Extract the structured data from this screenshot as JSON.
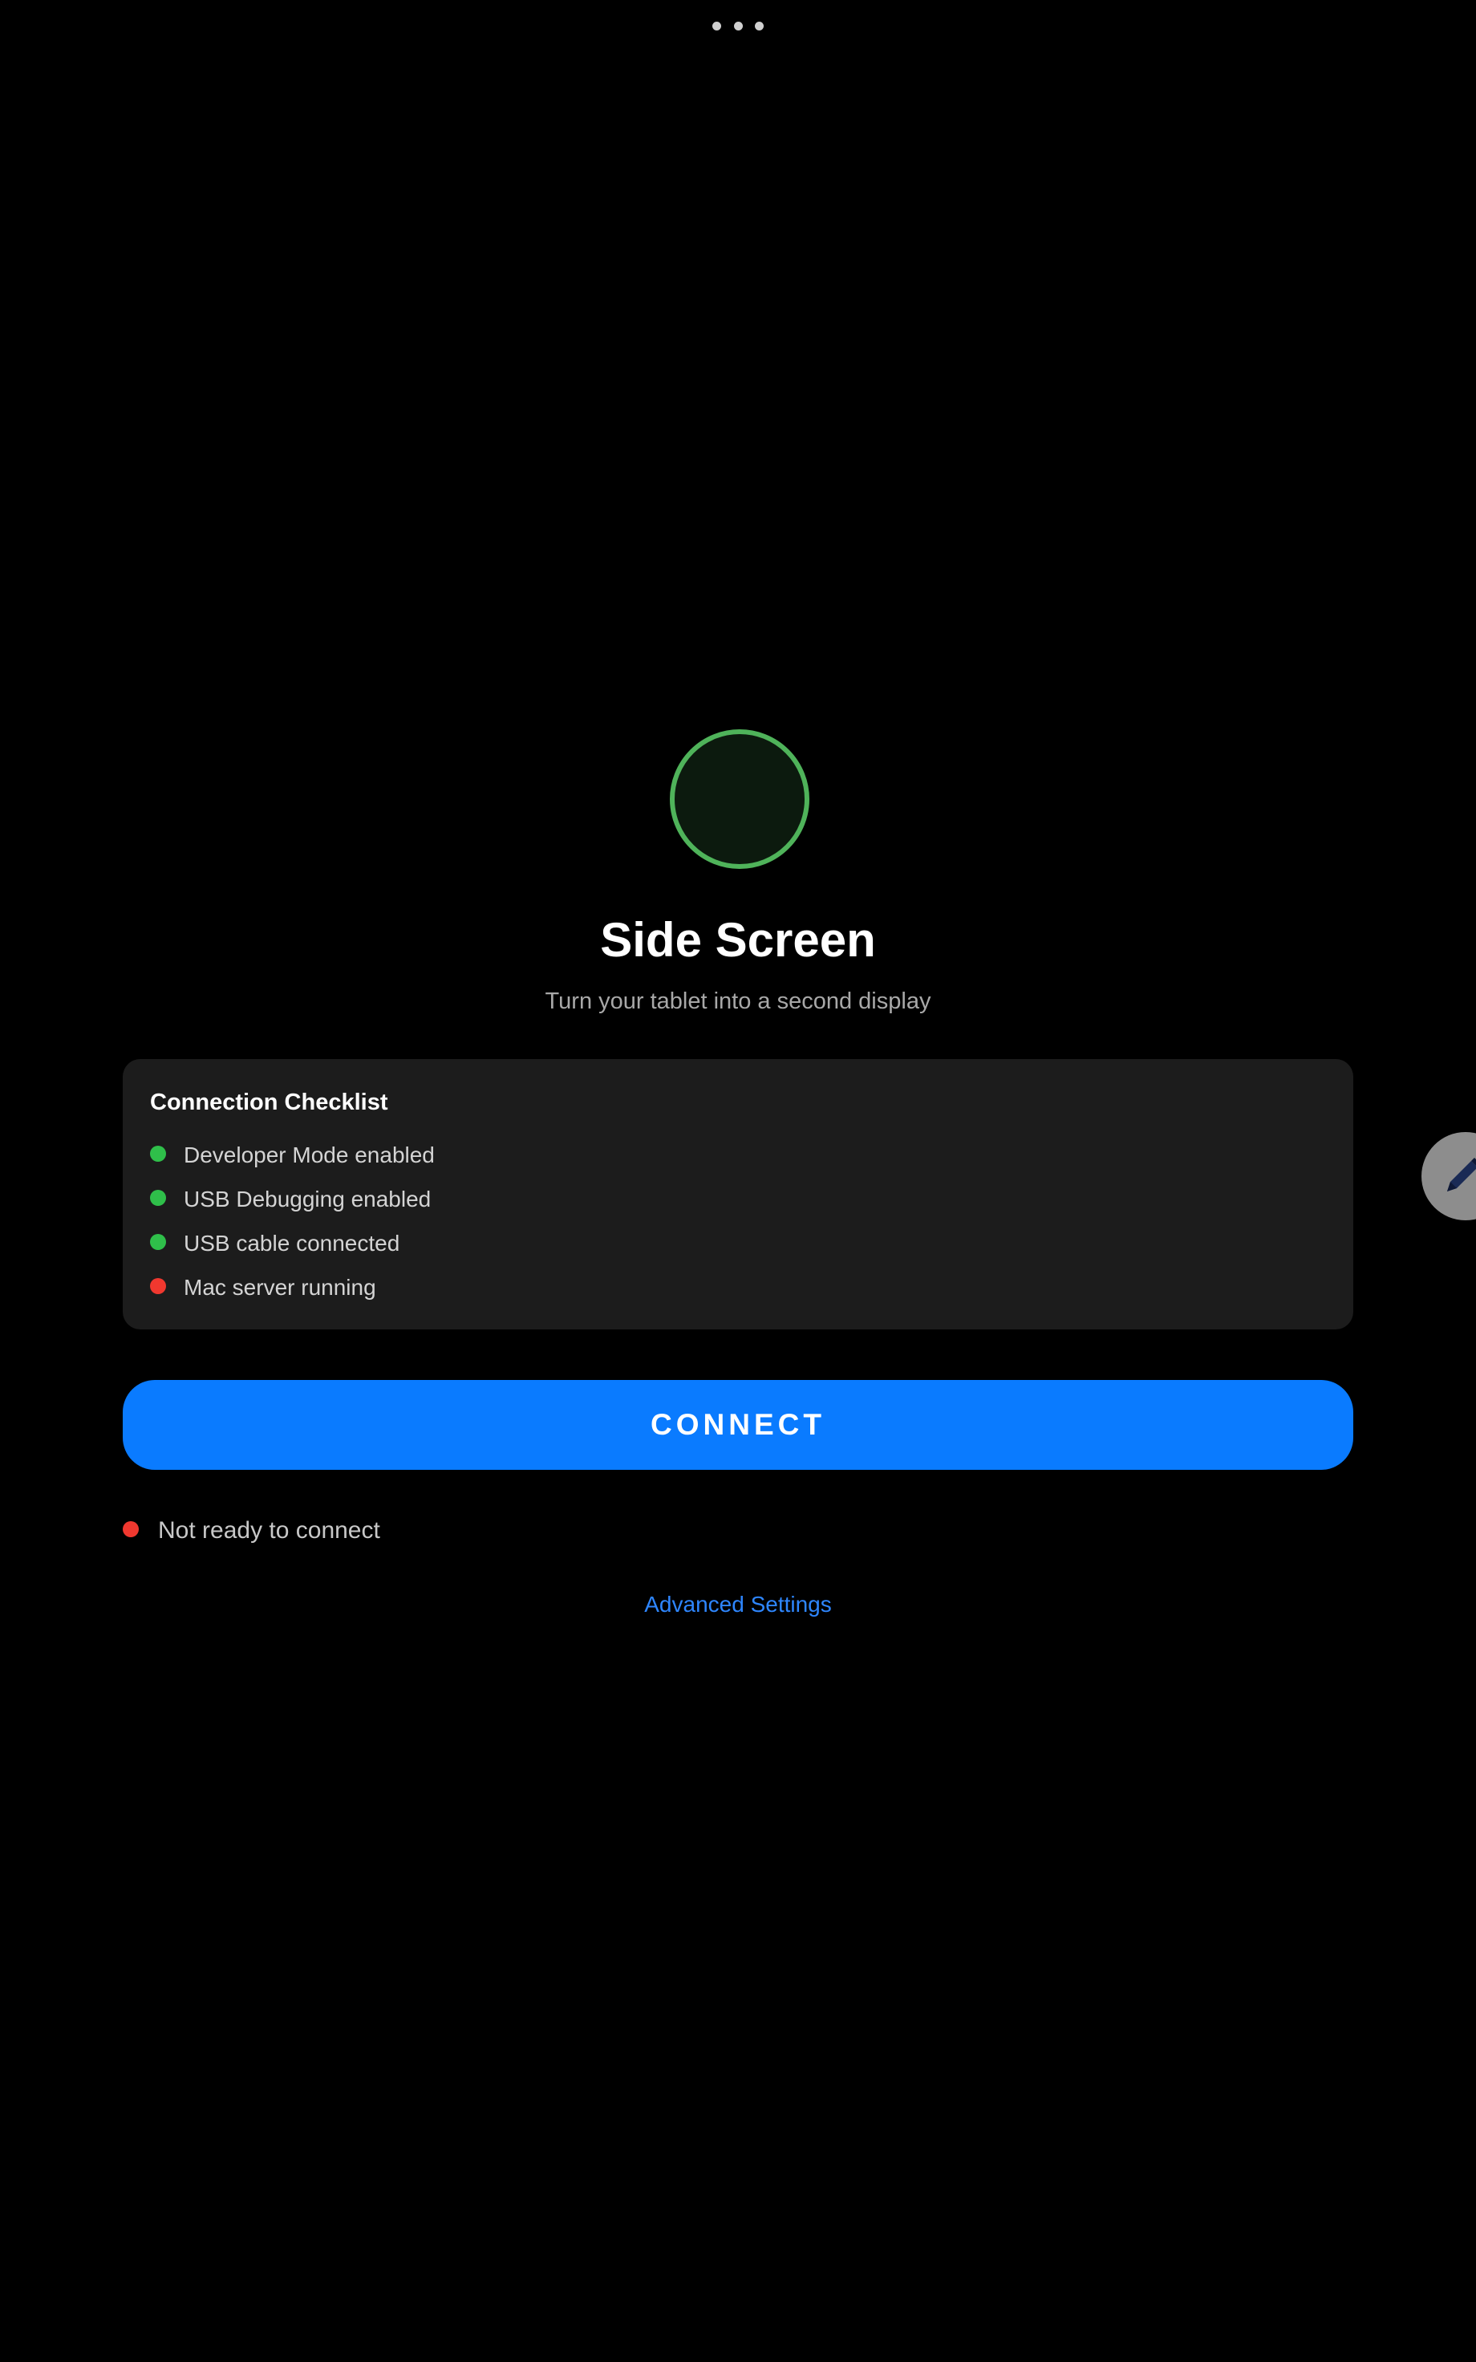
{
  "app": {
    "title": "Side Screen",
    "subtitle": "Turn your tablet into a second display"
  },
  "top_bar": {
    "menu_icon": "more-dots-icon"
  },
  "status_indicator": {
    "icon": "status-ring-icon",
    "color": "#4fb35a"
  },
  "checklist": {
    "title": "Connection Checklist",
    "items": [
      {
        "label": "Developer Mode enabled",
        "status": "ok",
        "color": "#2fbf4a"
      },
      {
        "label": "USB Debugging enabled",
        "status": "ok",
        "color": "#2fbf4a"
      },
      {
        "label": "USB cable connected",
        "status": "ok",
        "color": "#2fbf4a"
      },
      {
        "label": "Mac server running",
        "status": "error",
        "color": "#f0382f"
      }
    ]
  },
  "connect_button": {
    "label": "CONNECT",
    "color": "#0a7bff"
  },
  "connection_status": {
    "text": "Not ready to connect",
    "color": "#f0382f"
  },
  "advanced_settings": {
    "label": "Advanced Settings",
    "color": "#2e86ff"
  },
  "floating_button": {
    "icon": "pen-icon"
  }
}
